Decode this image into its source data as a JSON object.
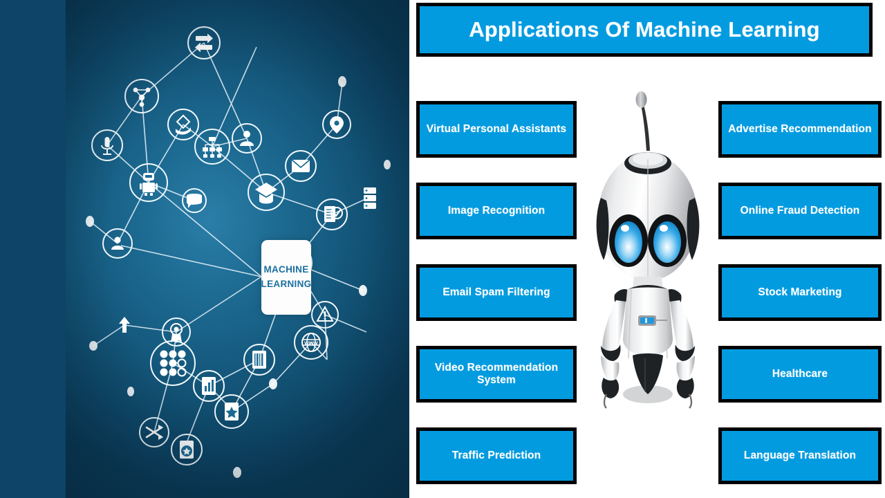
{
  "layout": {
    "left_panel_label": "machine-learning-network-illustration",
    "right_panel_label": "applications-list-panel"
  },
  "colors": {
    "accent_blue": "#039be0",
    "border_black": "#000000",
    "panel_navy": "#0d4467",
    "text_white": "#ffffff",
    "center_node_text": "#1a6fa0",
    "robot_eye_blue": "#29a8e8"
  },
  "header": {
    "title": "Applications Of Machine Learning"
  },
  "network": {
    "center_node": {
      "line1": "MACHINE",
      "line2": "LEARNING"
    },
    "node_icons": [
      "data-transfer-arrows-icon",
      "molecule-nodes-icon",
      "microphone-icon",
      "diamond-hand-icon",
      "robot-icon",
      "location-pin-icon",
      "envelope-icon",
      "org-chart-icon",
      "user-person-icon",
      "checklist-icon",
      "graduation-cap-icon",
      "signal-arrow-icon",
      "chat-bubble-icon",
      "chart-document-icon",
      "award-badge-icon",
      "dot-matrix-icon",
      "barcode-icon",
      "www-globe-icon",
      "shuffle-arrows-icon",
      "star-document-icon",
      "server-rack-icon",
      "atom-network-icon",
      "warning-alert-icon"
    ]
  },
  "applications": {
    "left_column": [
      {
        "label": "Virtual Personal Assistants"
      },
      {
        "label": "Image Recognition"
      },
      {
        "label": "Email Spam Filtering"
      },
      {
        "label": "Video Recommendation System"
      },
      {
        "label": "Traffic Prediction"
      }
    ],
    "right_column": [
      {
        "label": "Advertise Recommendation"
      },
      {
        "label": "Online Fraud Detection"
      },
      {
        "label": "Stock Marketing"
      },
      {
        "label": "Healthcare"
      },
      {
        "label": "Language Translation"
      }
    ]
  },
  "robot": {
    "name": "robot-illustration",
    "parts": [
      "antenna",
      "head",
      "eyes",
      "torso",
      "chest-indicator",
      "arms",
      "hands",
      "base",
      "shadow"
    ]
  }
}
